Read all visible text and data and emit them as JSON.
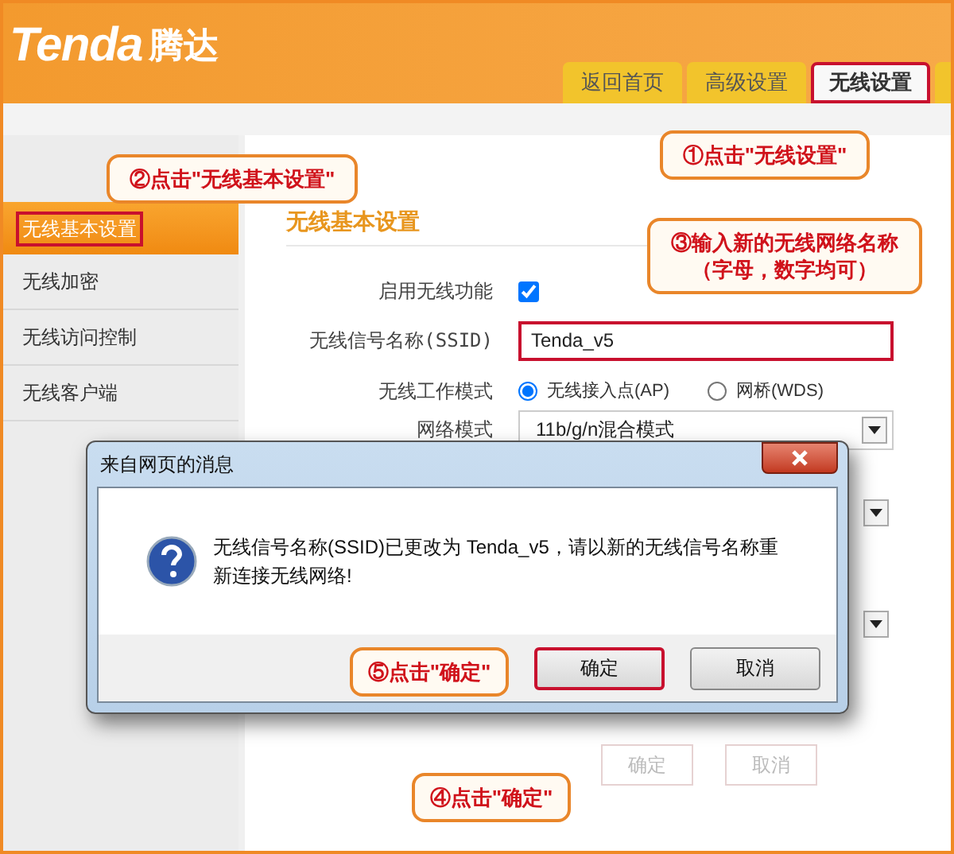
{
  "logo": {
    "brand": "Tenda",
    "name": "腾达"
  },
  "tabs": [
    {
      "label": "返回首页",
      "selected": false
    },
    {
      "label": "高级设置",
      "selected": false
    },
    {
      "label": "无线设置",
      "selected": true
    }
  ],
  "sidebar": {
    "items": [
      {
        "label": "无线基本设置",
        "selected": true
      },
      {
        "label": "无线加密",
        "selected": false
      },
      {
        "label": "无线访问控制",
        "selected": false
      },
      {
        "label": "无线客户端",
        "selected": false
      }
    ]
  },
  "section_title": "无线基本设置",
  "form": {
    "enable": {
      "label": "启用无线功能",
      "checked": true
    },
    "ssid": {
      "label": "无线信号名称(SSID)",
      "value": "Tenda_v5"
    },
    "mode": {
      "label": "无线工作模式",
      "options": [
        {
          "label": "无线接入点(AP)",
          "selected": true
        },
        {
          "label": "网桥(WDS)",
          "selected": false
        }
      ]
    },
    "network_mode": {
      "label": "网络模式",
      "value": "11b/g/n混合模式"
    }
  },
  "footer_buttons": [
    "确定",
    "取消"
  ],
  "dialog": {
    "title": "来自网页的消息",
    "message": "无线信号名称(SSID)已更改为 Tenda_v5，请以新的无线信号名称重新连接无线网络!",
    "buttons": [
      "确定",
      "取消"
    ]
  },
  "callouts": [
    {
      "lines": [
        "①点击\"无线设置\""
      ]
    },
    {
      "lines": [
        "②点击\"无线基本设置\""
      ]
    },
    {
      "lines": [
        "③输入新的无线网络名称",
        "（字母，数字均可）"
      ]
    },
    {
      "lines": [
        "④点击\"确定\""
      ]
    },
    {
      "lines": [
        "⑤点击\"确定\""
      ]
    }
  ]
}
